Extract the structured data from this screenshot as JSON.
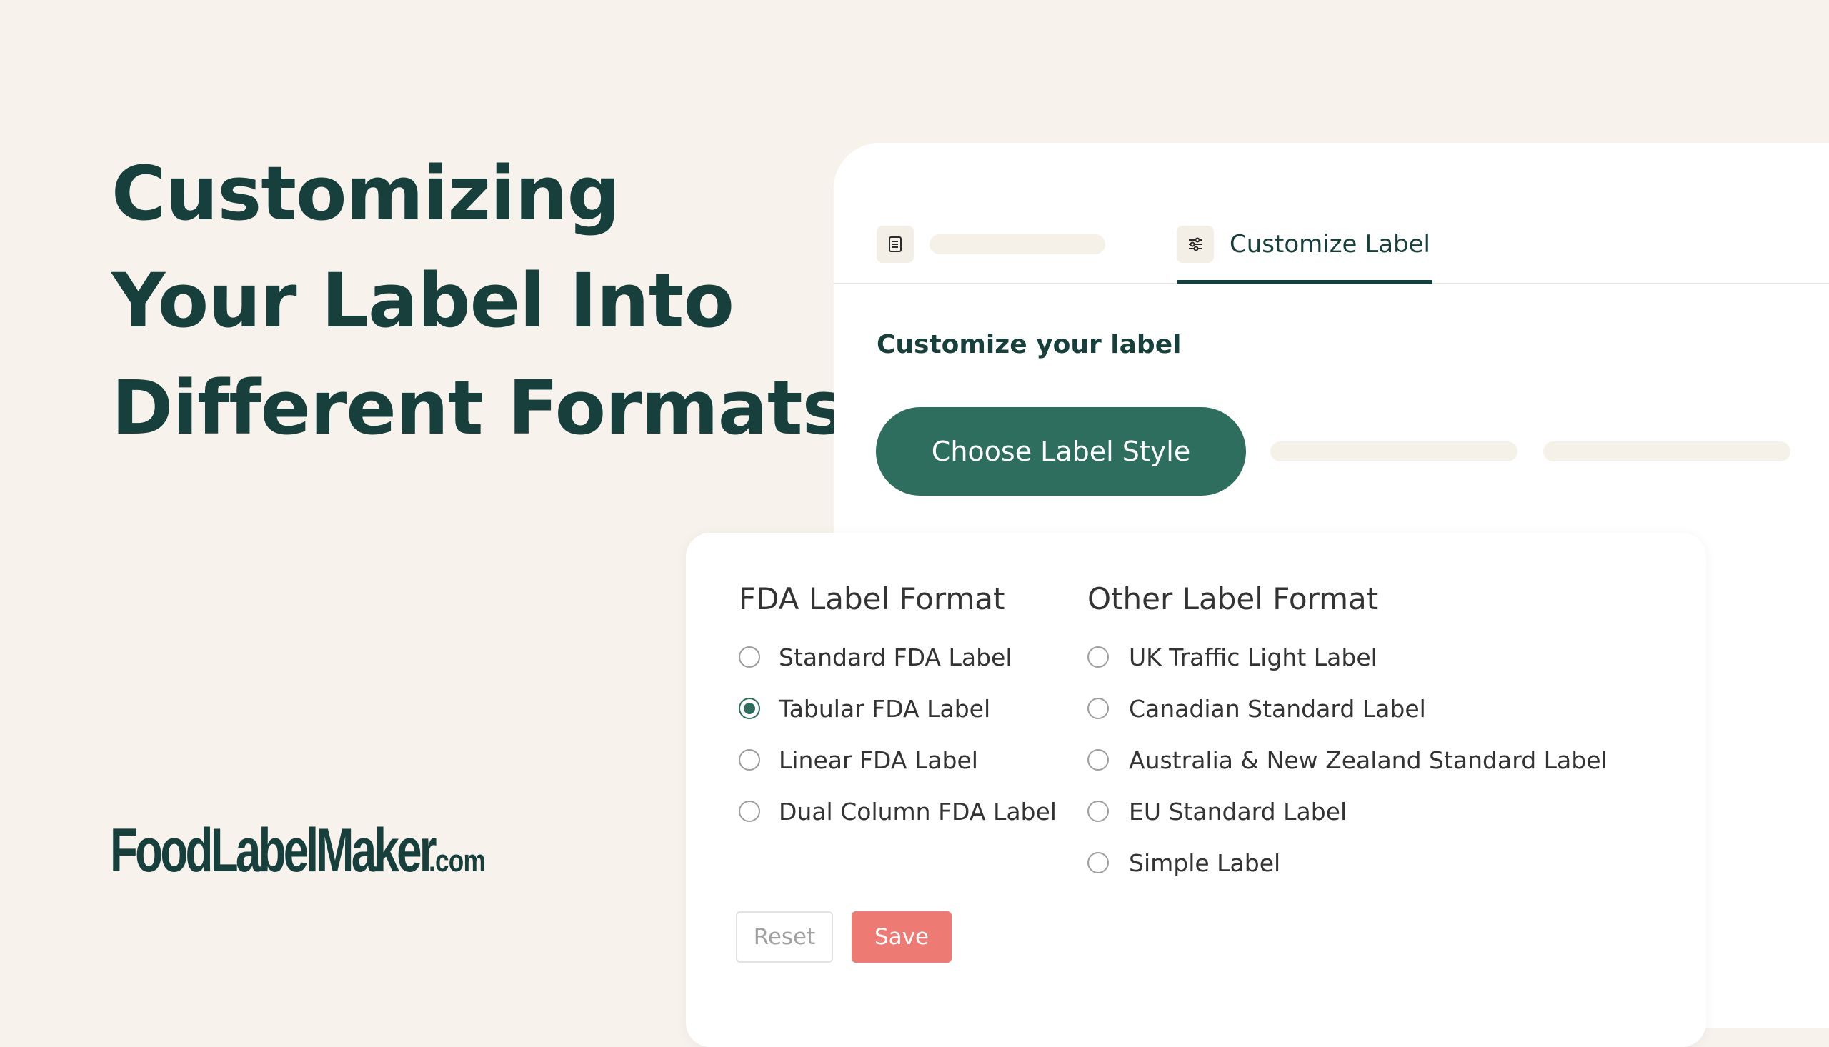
{
  "headline": {
    "line1": "Customizing",
    "line2": "Your Label Into",
    "line3": "Different Formats"
  },
  "logo": {
    "main": "FoodLabelMaker",
    "suffix": ".com"
  },
  "tabs": [
    {
      "label": "",
      "icon": "document-icon",
      "active": false
    },
    {
      "label": "Customize Label",
      "icon": "sliders-icon",
      "active": true
    }
  ],
  "section": {
    "title": "Customize your label",
    "style_button": "Choose Label Style"
  },
  "fda": {
    "title": "FDA Label Format",
    "options": [
      {
        "label": "Standard FDA Label",
        "selected": false
      },
      {
        "label": "Tabular FDA Label",
        "selected": true
      },
      {
        "label": "Linear FDA Label",
        "selected": false
      },
      {
        "label": "Dual Column FDA Label",
        "selected": false
      }
    ]
  },
  "other": {
    "title": "Other Label Format",
    "options": [
      {
        "label": "UK Traffic Light Label",
        "selected": false
      },
      {
        "label": "Canadian Standard Label",
        "selected": false
      },
      {
        "label": "Australia & New Zealand Standard Label",
        "selected": false
      },
      {
        "label": "EU Standard Label",
        "selected": false
      },
      {
        "label": "Simple Label",
        "selected": false
      }
    ]
  },
  "actions": {
    "reset": "Reset",
    "save": "Save"
  },
  "colors": {
    "background": "#f7f3ec",
    "brand_dark": "#17403c",
    "brand_green": "#2e6e5e",
    "save_coral": "#ee7b73"
  }
}
